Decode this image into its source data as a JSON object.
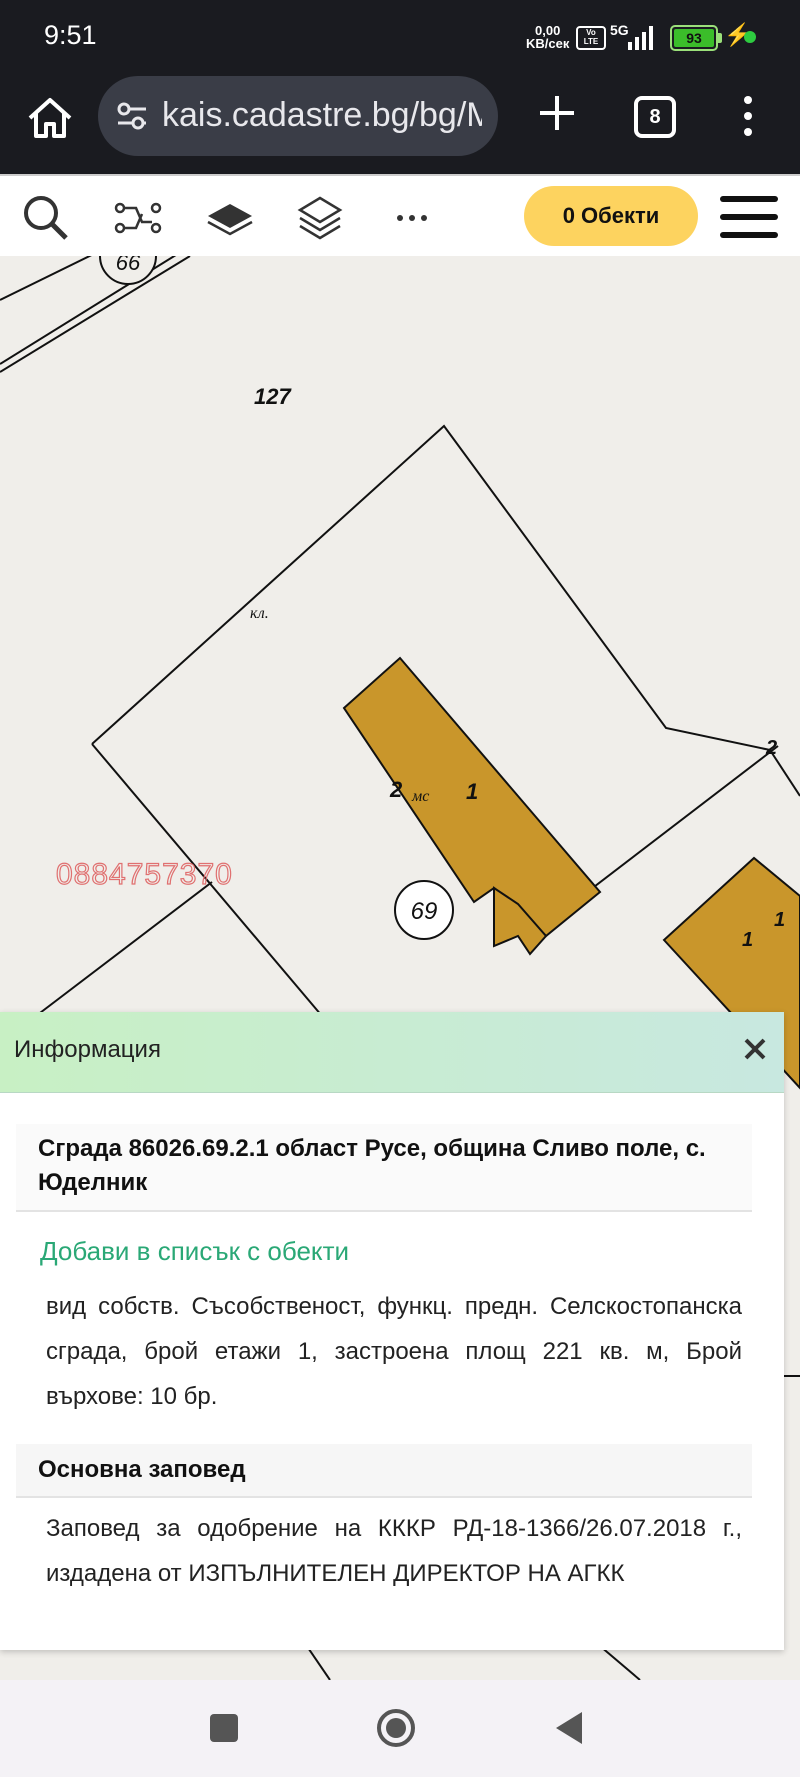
{
  "status_bar": {
    "time": "9:51",
    "net_speed_value": "0,00",
    "net_speed_unit": "KB/сек",
    "volte_label": "Vo LTE",
    "network_type": "5G",
    "battery_level": "93",
    "colors": {
      "background": "#1a1b20",
      "battery": "#3bbd2a"
    }
  },
  "browser": {
    "url": "kais.cadastre.bg/bg/M",
    "tab_count": "8",
    "icons": [
      "home-icon",
      "tune-icon",
      "plus-icon",
      "tabs-icon",
      "more-vert-icon"
    ]
  },
  "toolbar": {
    "objects_button": "0 Обекти",
    "icons": [
      "search-icon",
      "route-icon",
      "layer-icon",
      "layers-icon",
      "more-horiz-icon",
      "menu-icon"
    ],
    "accent_color": "#fdd35f"
  },
  "map": {
    "labels": {
      "parcel_top": "127",
      "top_circle": "66",
      "kl": "кл.",
      "building_number": "2",
      "building_ms": "мс",
      "building_floors": "1",
      "parcel_id": "69",
      "corner_number": "2",
      "right_building_a": "1",
      "right_building_b": "1"
    },
    "watermark_phone": "0884757370",
    "building_color": "#c9962b"
  },
  "info_panel": {
    "title": "Информация",
    "object_title": "Сграда 86026.69.2.1 област Русе, община Сливо поле, с. Юделник",
    "add_to_list": "Добави в списък с обекти",
    "description": "вид собств. Съсобственост, функц. предн. Селскостопанска сграда, брой етажи 1, застроена площ 221 кв. м, Брой върхове: 10 бр.",
    "section_title": "Основна заповед",
    "order_text": "Заповед за одобрение на КККР РД-18-1366/26.07.2018 г., издадена от ИЗПЪЛНИТЕЛЕН ДИРЕКТОР НА АГКК",
    "link_color": "#2aa876"
  },
  "nav_bar": {
    "icons": [
      "recents-icon",
      "home-icon",
      "back-icon"
    ]
  }
}
